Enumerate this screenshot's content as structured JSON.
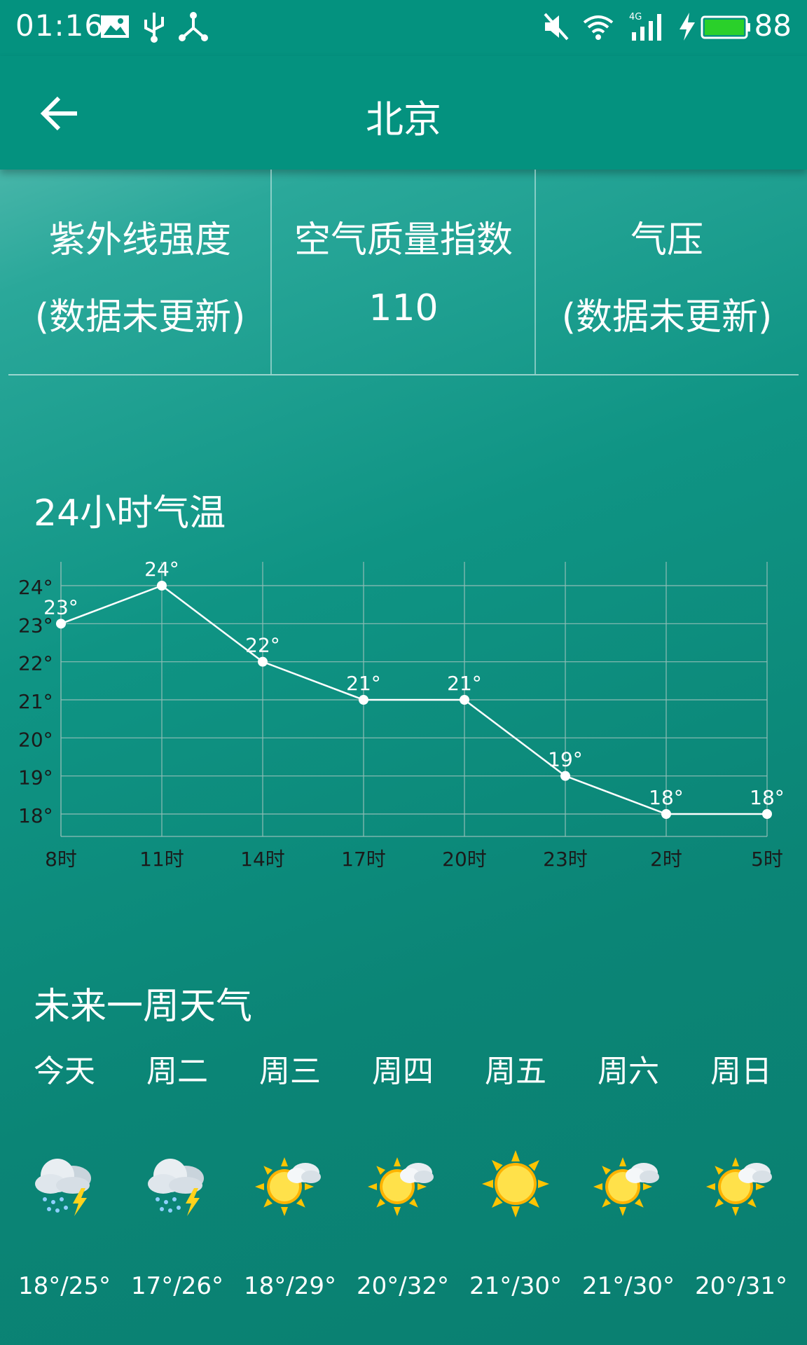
{
  "status_bar": {
    "time": "01:16",
    "battery": "88",
    "icons": [
      "image-icon",
      "usb-icon",
      "share-network-icon",
      "mute-icon",
      "wifi-icon",
      "signal-4g-icon",
      "charging-icon",
      "battery-icon"
    ]
  },
  "app_bar": {
    "title": "北京",
    "back_icon": "arrow-left-icon"
  },
  "info": [
    {
      "label": "紫外线强度",
      "value": "(数据未更新)"
    },
    {
      "label": "空气质量指数",
      "value": "110"
    },
    {
      "label": "气压",
      "value": "(数据未更新)"
    }
  ],
  "hourly": {
    "title": "24小时气温"
  },
  "chart_data": {
    "type": "line",
    "title": "24小时气温",
    "categories": [
      "8时",
      "11时",
      "14时",
      "17时",
      "20时",
      "23时",
      "2时",
      "5时"
    ],
    "values": [
      23,
      24,
      22,
      21,
      21,
      19,
      18,
      18
    ],
    "value_labels": [
      "23°",
      "24°",
      "22°",
      "21°",
      "21°",
      "19°",
      "18°",
      "18°"
    ],
    "y_ticks": [
      "24°",
      "23°",
      "22°",
      "21°",
      "20°",
      "19°",
      "18°"
    ],
    "y_tick_values": [
      24,
      23,
      22,
      21,
      20,
      19,
      18
    ],
    "ylim": [
      18,
      24
    ],
    "grid": true,
    "colors": {
      "line": "#ffffff",
      "grid": "#8fbdb6",
      "axis_text": "#1b1b1b"
    }
  },
  "weekly": {
    "title": "未来一周天气",
    "days": [
      {
        "name": "今天",
        "range": "18°/25°",
        "icon": "thunderstorm-icon"
      },
      {
        "name": "周二",
        "range": "17°/26°",
        "icon": "thunderstorm-icon"
      },
      {
        "name": "周三",
        "range": "18°/29°",
        "icon": "sun-cloud-icon"
      },
      {
        "name": "周四",
        "range": "20°/32°",
        "icon": "sun-cloud-icon"
      },
      {
        "name": "周五",
        "range": "21°/30°",
        "icon": "sun-icon"
      },
      {
        "name": "周六",
        "range": "21°/30°",
        "icon": "sun-cloud-icon"
      },
      {
        "name": "周日",
        "range": "20°/31°",
        "icon": "sun-cloud-icon"
      }
    ]
  }
}
